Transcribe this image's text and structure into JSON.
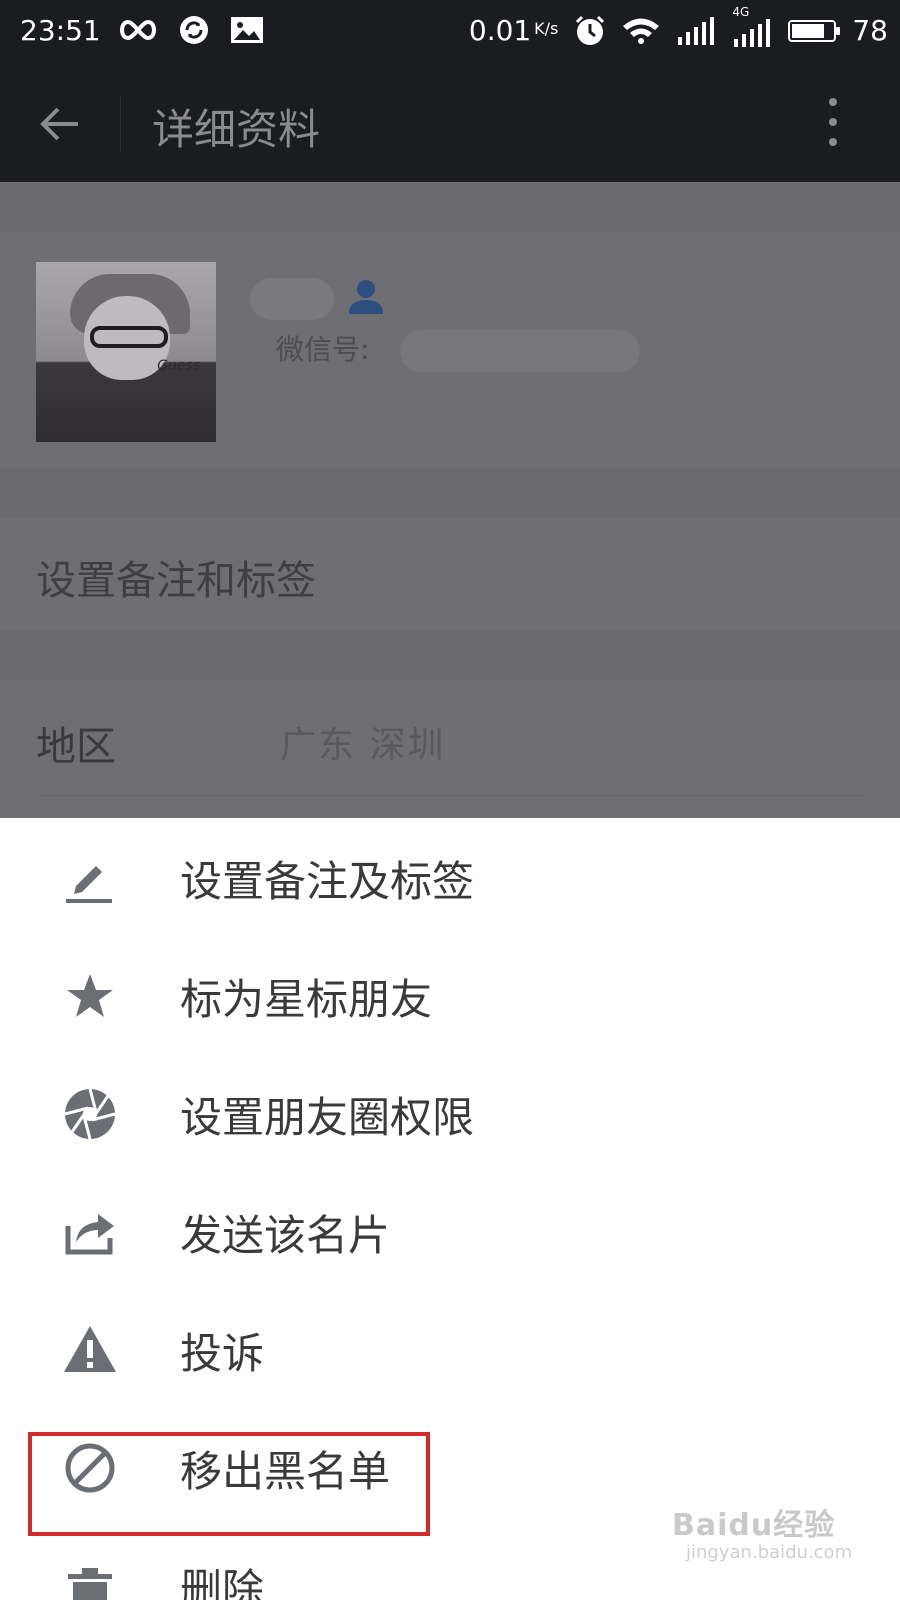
{
  "status_bar": {
    "time": "23:51",
    "net_speed": "0.01",
    "net_speed_unit": "K/s",
    "battery": "78",
    "battery_level_percent": 78,
    "network_type": "4G",
    "icons": [
      "infinity-icon",
      "sync-icon",
      "image-icon",
      "alarm-icon",
      "wifi-icon",
      "signal-icon",
      "signal-4g-icon",
      "battery-icon"
    ]
  },
  "action_bar": {
    "title": "详细资料",
    "back_icon": "back-arrow-icon",
    "more_icon": "more-vert-icon"
  },
  "profile": {
    "wechat_id_label": "微信号:",
    "avatar_caption": "Guess"
  },
  "remark_row": {
    "label": "设置备注和标签"
  },
  "region_row": {
    "label": "地区",
    "value": "广东  深圳"
  },
  "menu": {
    "items": [
      {
        "label": "设置备注及标签",
        "icon": "edit-icon"
      },
      {
        "label": "标为星标朋友",
        "icon": "star-icon"
      },
      {
        "label": "设置朋友圈权限",
        "icon": "aperture-icon"
      },
      {
        "label": "发送该名片",
        "icon": "share-icon"
      },
      {
        "label": "投诉",
        "icon": "warning-icon"
      },
      {
        "label": "移出黑名单",
        "icon": "block-icon"
      },
      {
        "label": "删除",
        "icon": "trash-icon"
      }
    ],
    "highlighted_index": 5
  },
  "colors": {
    "highlight": "#d32a2a",
    "status_bar_bg": "#1b1c20",
    "menu_icon": "#6b6e72"
  },
  "watermark": {
    "logo": "Baidu经验",
    "url": "jingyan.baidu.com"
  }
}
